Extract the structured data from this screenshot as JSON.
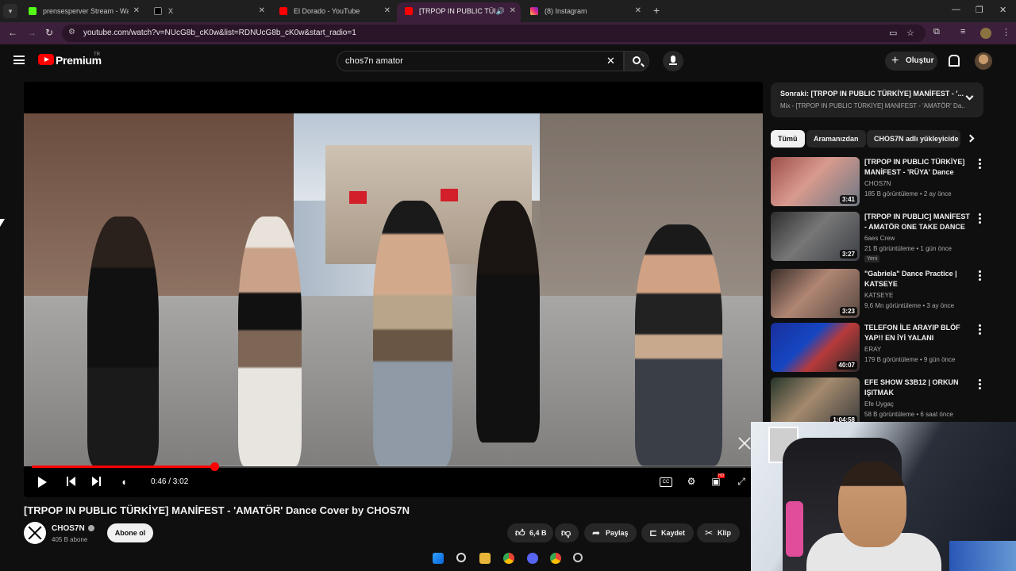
{
  "browser": {
    "tabs": [
      {
        "title": "prensesperver Stream - Watch L",
        "active": false
      },
      {
        "title": "X",
        "active": false
      },
      {
        "title": "El Dorado - YouTube",
        "active": false
      },
      {
        "title": "[TRPOP IN PUBLIC TÜRKİYE",
        "active": true
      },
      {
        "title": "(8) Instagram",
        "active": false
      }
    ],
    "url": "youtube.com/watch?v=NUcG8b_cK0w&list=RDNUcG8b_cK0w&start_radio=1"
  },
  "header": {
    "brand": "Premium",
    "country": "TR",
    "search_value": "chos7n amator",
    "create_label": "Oluştur"
  },
  "player": {
    "time": "0:46 / 3:02",
    "progress": 0.253,
    "hd_badge": "HD"
  },
  "video": {
    "title": "[TRPOP IN PUBLIC TÜRKİYE] MANİFEST - 'AMATÖR' Dance Cover by CHOS7N",
    "channel": "CHOS7N",
    "subscribers": "405 B abone",
    "subscribe_label": "Abone ol",
    "likes": "6,4 B",
    "share_label": "Paylaş",
    "save_label": "Kaydet",
    "clip_label": "Klip"
  },
  "up_next": {
    "title": "Sonraki: [TRPOP IN PUBLIC TÜRKİYE] MANİFEST - '...",
    "subtitle": "Mix - [TRPOP IN PUBLIC TÜRKİYE] MANİFEST - 'AMATÖR' Da..."
  },
  "chips": [
    "Tümü",
    "Aramanızdan",
    "CHOS7N adlı yükleyicide"
  ],
  "recommendations": [
    {
      "title": "[TRPOP IN PUBLIC TÜRKİYE] MANİFEST - 'RÜYA' Dance Cov...",
      "channel": "CHOS7N",
      "meta": "185 B görüntüleme • 2 ay önce",
      "duration": "3:41",
      "badge": ""
    },
    {
      "title": "[TRPOP IN PUBLIC] MANİFEST - AMATÖR ONE TAKE DANCE ...",
      "channel": "6aes Crew",
      "meta": "21 B görüntüleme • 1 gün önce",
      "duration": "3:27",
      "badge": "Yeni"
    },
    {
      "title": "\"Gabriela\" Dance Practice | KATSEYE",
      "channel": "KATSEYE",
      "meta": "9,6 Mn görüntüleme • 3 ay önce",
      "duration": "3:23",
      "badge": ""
    },
    {
      "title": "TELEFON İLE ARAYIP BLÖF YAP!! EN İYİ YALANI SÖYLEYE...",
      "channel": "ERAY",
      "meta": "179 B görüntüleme • 9 gün önce",
      "duration": "40:07",
      "badge": ""
    },
    {
      "title": "EFE SHOW S3B12 | ORKUN IŞITMAK",
      "channel": "Efe Uygaç",
      "meta": "58 B görüntüleme • 6 saat önce",
      "duration": "1:04:58",
      "badge": ""
    }
  ],
  "colors": {
    "accent": "#ff0000",
    "background": "#0f0f0f",
    "tab_active": "#3c1f3a"
  }
}
